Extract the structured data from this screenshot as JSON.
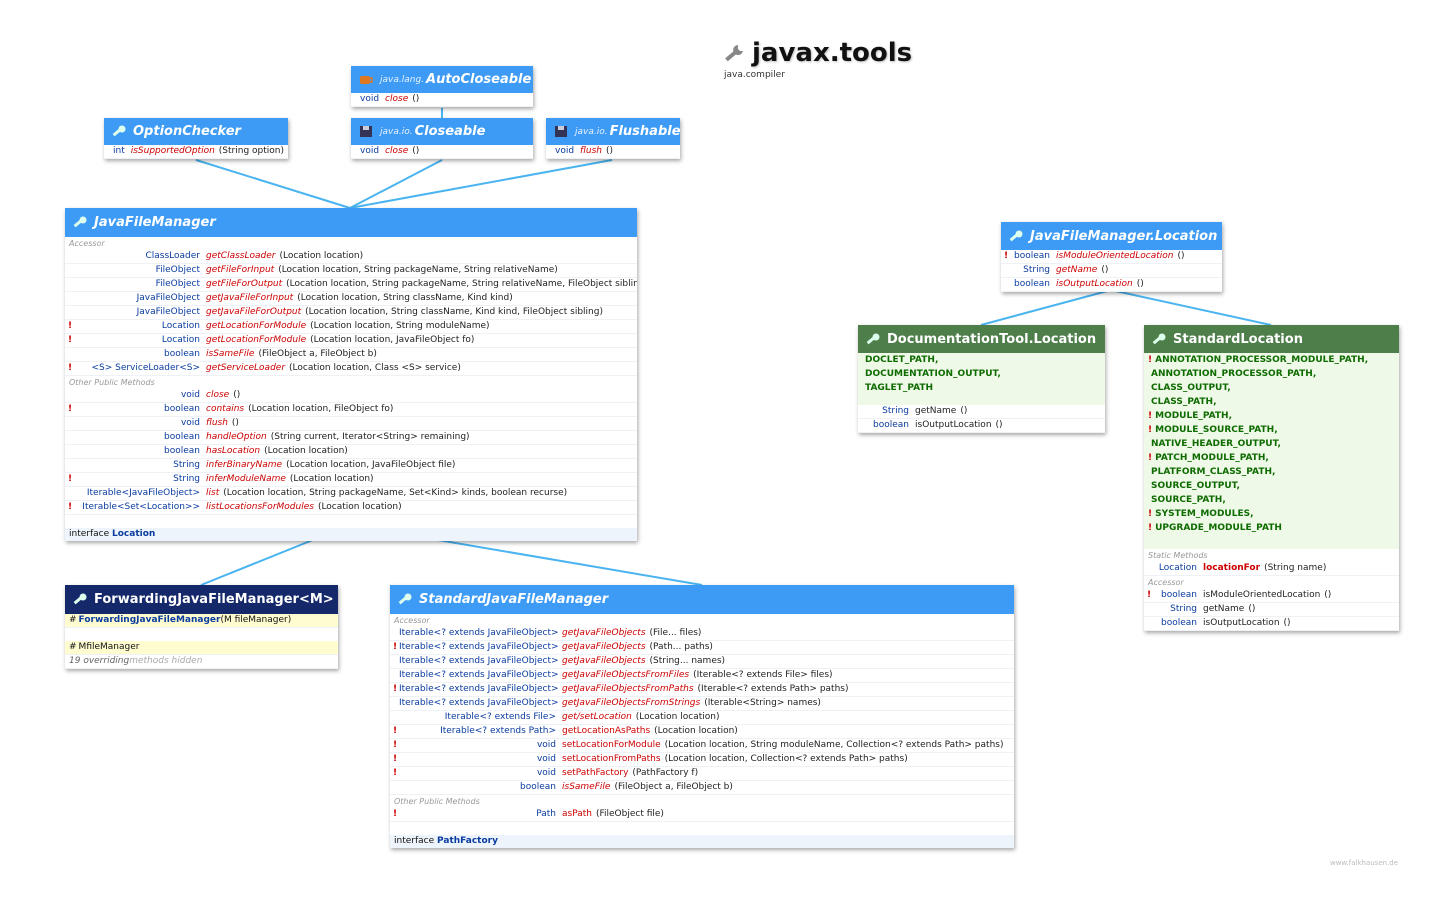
{
  "title": "javax.tools",
  "module": "java.compiler",
  "credit": "www.falkhausen.de",
  "colors": {
    "blue": "#3d9bf5",
    "green": "#4e7e4a",
    "navy": "#14286a",
    "edge": "#4ab4f0"
  },
  "autocloseable": {
    "pkg": "java.lang.",
    "name": "AutoCloseable",
    "rows": [
      {
        "type": "void",
        "name": "close",
        "args": " ()"
      }
    ]
  },
  "closeable": {
    "pkg": "java.io.",
    "name": "Closeable",
    "rows": [
      {
        "type": "void",
        "name": "close",
        "args": " ()"
      }
    ]
  },
  "flushable": {
    "pkg": "java.io.",
    "name": "Flushable",
    "rows": [
      {
        "type": "void",
        "name": "flush",
        "args": " ()"
      }
    ]
  },
  "optionchecker": {
    "name": "OptionChecker",
    "rows": [
      {
        "type": "int",
        "name": "isSupportedOption",
        "args": " (String option)"
      }
    ]
  },
  "javafilemanager": {
    "name": "JavaFileManager",
    "sections": [
      {
        "label": "Accessor",
        "rows": [
          {
            "type": "ClassLoader",
            "name": "getClassLoader",
            "args": " (Location location)"
          },
          {
            "type": "FileObject",
            "name": "getFileForInput",
            "args": " (Location location, String packageName, String relativeName)"
          },
          {
            "type": "FileObject",
            "name": "getFileForOutput",
            "args": " (Location location, String packageName, String relativeName, FileObject sibling)"
          },
          {
            "type": "JavaFileObject",
            "name": "getJavaFileForInput",
            "args": " (Location location, String className, Kind kind)"
          },
          {
            "type": "JavaFileObject",
            "name": "getJavaFileForOutput",
            "args": " (Location location, String className, Kind kind, FileObject sibling)"
          },
          {
            "excl": "!",
            "type": "Location",
            "name": "getLocationForModule",
            "args": " (Location location, String moduleName)"
          },
          {
            "excl": "!",
            "type": "Location",
            "name": "getLocationForModule",
            "args": " (Location location, JavaFileObject fo)"
          },
          {
            "type": "boolean",
            "name": "isSameFile",
            "args": " (FileObject a, FileObject b)"
          },
          {
            "excl": "!",
            "type": "<S> ServiceLoader<S>",
            "name": "getServiceLoader",
            "args": " (Location location, Class <S> service)"
          }
        ]
      },
      {
        "label": "Other Public Methods",
        "rows": [
          {
            "type": "void",
            "name": "close",
            "args": " ()"
          },
          {
            "excl": "!",
            "type": "boolean",
            "name": "contains",
            "args": " (Location location, FileObject fo)"
          },
          {
            "type": "void",
            "name": "flush",
            "args": " ()"
          },
          {
            "type": "boolean",
            "name": "handleOption",
            "args": " (String current, Iterator<String> remaining)"
          },
          {
            "type": "boolean",
            "name": "hasLocation",
            "args": " (Location location)"
          },
          {
            "type": "String",
            "name": "inferBinaryName",
            "args": " (Location location, JavaFileObject file)"
          },
          {
            "excl": "!",
            "type": "String",
            "name": "inferModuleName",
            "args": " (Location location)"
          },
          {
            "type": "Iterable<JavaFileObject>",
            "name": "list",
            "args": " (Location location, String packageName, Set<Kind> kinds, boolean recurse)"
          },
          {
            "excl": "!",
            "type": "Iterable<Set<Location>>",
            "name": "listLocationsForModules",
            "args": " (Location location)"
          }
        ]
      }
    ],
    "footer_prefix": "interface ",
    "footer_name": "Location"
  },
  "location": {
    "name": "JavaFileManager.Location",
    "rows": [
      {
        "excl": "!",
        "type": "boolean",
        "name": "isModuleOrientedLocation",
        "args": " ()"
      },
      {
        "type": "String",
        "name": "getName",
        "args": " ()"
      },
      {
        "type": "boolean",
        "name": "isOutputLocation",
        "args": " ()"
      }
    ]
  },
  "doclocation": {
    "name": "DocumentationTool.Location",
    "constants": [
      {
        "excl": "",
        "name": "DOCLET_PATH,"
      },
      {
        "excl": "",
        "name": "DOCUMENTATION_OUTPUT,"
      },
      {
        "excl": "",
        "name": "TAGLET_PATH"
      }
    ],
    "rows": [
      {
        "type": "String",
        "name": "getName",
        "args": " ()"
      },
      {
        "type": "boolean",
        "name": "isOutputLocation",
        "args": " ()"
      }
    ]
  },
  "stdlocation": {
    "name": "StandardLocation",
    "constants": [
      {
        "excl": "!",
        "name": "ANNOTATION_PROCESSOR_MODULE_PATH,"
      },
      {
        "excl": "",
        "name": "ANNOTATION_PROCESSOR_PATH,"
      },
      {
        "excl": "",
        "name": "CLASS_OUTPUT,"
      },
      {
        "excl": "",
        "name": "CLASS_PATH,"
      },
      {
        "excl": "!",
        "name": "MODULE_PATH,"
      },
      {
        "excl": "!",
        "name": "MODULE_SOURCE_PATH,"
      },
      {
        "excl": "",
        "name": "NATIVE_HEADER_OUTPUT,"
      },
      {
        "excl": "!",
        "name": "PATCH_MODULE_PATH,"
      },
      {
        "excl": "",
        "name": "PLATFORM_CLASS_PATH,"
      },
      {
        "excl": "",
        "name": "SOURCE_OUTPUT,"
      },
      {
        "excl": "",
        "name": "SOURCE_PATH,"
      },
      {
        "excl": "!",
        "name": "SYSTEM_MODULES,"
      },
      {
        "excl": "!",
        "name": "UPGRADE_MODULE_PATH"
      }
    ],
    "static_label": "Static Methods",
    "static_rows": [
      {
        "type": "Location",
        "name": "locationFor",
        "args": " (String name)"
      }
    ],
    "accessor_label": "Accessor",
    "accessor_rows": [
      {
        "excl": "!",
        "type": "boolean",
        "name": "isModuleOrientedLocation",
        "args": " ()"
      },
      {
        "type": "String",
        "name": "getName",
        "args": " ()"
      },
      {
        "type": "boolean",
        "name": "isOutputLocation",
        "args": " ()"
      }
    ]
  },
  "forwarding": {
    "name": "ForwardingJavaFileManager<M>",
    "ctor_hash": "#",
    "ctor_name": "ForwardingJavaFileManager",
    "ctor_args": " (M fileManager)",
    "field_hash": "#",
    "field_type": "M",
    "field_name": " fileManager",
    "hidden_count": "19 overriding",
    "hidden_text": " methods hidden"
  },
  "standardjfm": {
    "name": "StandardJavaFileManager",
    "sections": [
      {
        "label": "Accessor",
        "rows": [
          {
            "type": "Iterable<? extends JavaFileObject>",
            "name": "getJavaFileObjects",
            "args": " (File... files)"
          },
          {
            "excl": "!",
            "type": "Iterable<? extends JavaFileObject>",
            "name": "getJavaFileObjects",
            "args": " (Path... paths)"
          },
          {
            "type": "Iterable<? extends JavaFileObject>",
            "name": "getJavaFileObjects",
            "args": " (String... names)"
          },
          {
            "type": "Iterable<? extends JavaFileObject>",
            "name": "getJavaFileObjectsFromFiles",
            "args": " (Iterable<? extends File> files)"
          },
          {
            "excl": "!",
            "type": "Iterable<? extends JavaFileObject>",
            "name": "getJavaFileObjectsFromPaths",
            "args": " (Iterable<? extends Path> paths)"
          },
          {
            "type": "Iterable<? extends JavaFileObject>",
            "name": "getJavaFileObjectsFromStrings",
            "args": " (Iterable<String> names)"
          },
          {
            "type": "Iterable<? extends File>",
            "name": "get/setLocation",
            "args": " (Location location)"
          },
          {
            "excl": "!",
            "type": "Iterable<? extends Path>",
            "name": "getLocationAsPaths",
            "args": " (Location location)",
            "plain": true
          },
          {
            "excl": "!",
            "type": "void",
            "name": "setLocationForModule",
            "args": " (Location location, String moduleName, Collection<? extends Path> paths)",
            "plain": true
          },
          {
            "excl": "!",
            "type": "void",
            "name": "setLocationFromPaths",
            "args": " (Location location, Collection<? extends Path> paths)",
            "plain": true
          },
          {
            "excl": "!",
            "type": "void",
            "name": "setPathFactory",
            "args": " (PathFactory f)",
            "plain": true
          },
          {
            "type": "boolean",
            "name": "isSameFile",
            "args": " (FileObject a, FileObject b)"
          }
        ]
      },
      {
        "label": "Other Public Methods",
        "rows": [
          {
            "excl": "!",
            "type": "Path",
            "name": "asPath",
            "args": " (FileObject file)",
            "plain": true
          }
        ]
      }
    ],
    "footer_prefix": "interface ",
    "footer_name": "PathFactory"
  }
}
